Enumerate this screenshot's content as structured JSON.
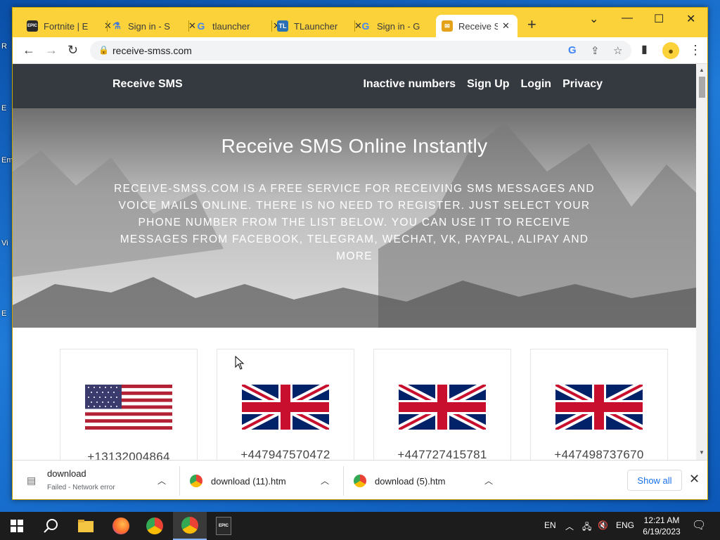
{
  "browser": {
    "tabs": [
      {
        "label": "Fortnite | E",
        "icon": "epic-games-icon",
        "color": "#2a2a2a",
        "glyph": "EPIC"
      },
      {
        "label": "Sign in - S",
        "icon": "flask-icon",
        "color": "#4a7bd4",
        "glyph": "⚗"
      },
      {
        "label": "tlauncher",
        "icon": "google-icon",
        "color": "#4285f4",
        "glyph": "G"
      },
      {
        "label": "TLauncher",
        "icon": "tlauncher-icon",
        "color": "#2b6fb5",
        "glyph": "TL"
      },
      {
        "label": "Sign in - G",
        "icon": "google-icon",
        "color": "#4285f4",
        "glyph": "G"
      },
      {
        "label": "Receive SMS",
        "icon": "sms-site-icon",
        "color": "#e3a21a",
        "glyph": "✉"
      }
    ],
    "url": "receive-smss.com"
  },
  "site": {
    "brand": "Receive SMS",
    "nav": [
      "Inactive numbers",
      "Sign Up",
      "Login",
      "Privacy"
    ],
    "hero_title": "Receive SMS Online Instantly",
    "hero_text": "RECEIVE-SMSS.COM IS A FREE SERVICE FOR RECEIVING SMS MESSAGES AND VOICE MAILS ONLINE. THERE IS NO NEED TO REGISTER. JUST SELECT YOUR PHONE NUMBER FROM THE LIST BELOW. YOU CAN USE IT TO RECEIVE MESSAGES FROM FACEBOOK, TELEGRAM, WECHAT, VK, PAYPAL, ALIPAY AND MORE",
    "numbers": [
      {
        "country": "US",
        "number": "+13132004864"
      },
      {
        "country": "GB",
        "number": "+447947570472"
      },
      {
        "country": "GB",
        "number": "+447727415781"
      },
      {
        "country": "GB",
        "number": "+447498737670"
      }
    ]
  },
  "downloads": {
    "items": [
      {
        "name": "download",
        "status": "Failed - Network error"
      },
      {
        "name": "download (11).htm",
        "status": ""
      },
      {
        "name": "download (5).htm",
        "status": ""
      }
    ],
    "show_all": "Show all"
  },
  "taskbar": {
    "lang": "EN",
    "ime": "ENG",
    "time": "12:21 AM",
    "date": "6/19/2023"
  }
}
